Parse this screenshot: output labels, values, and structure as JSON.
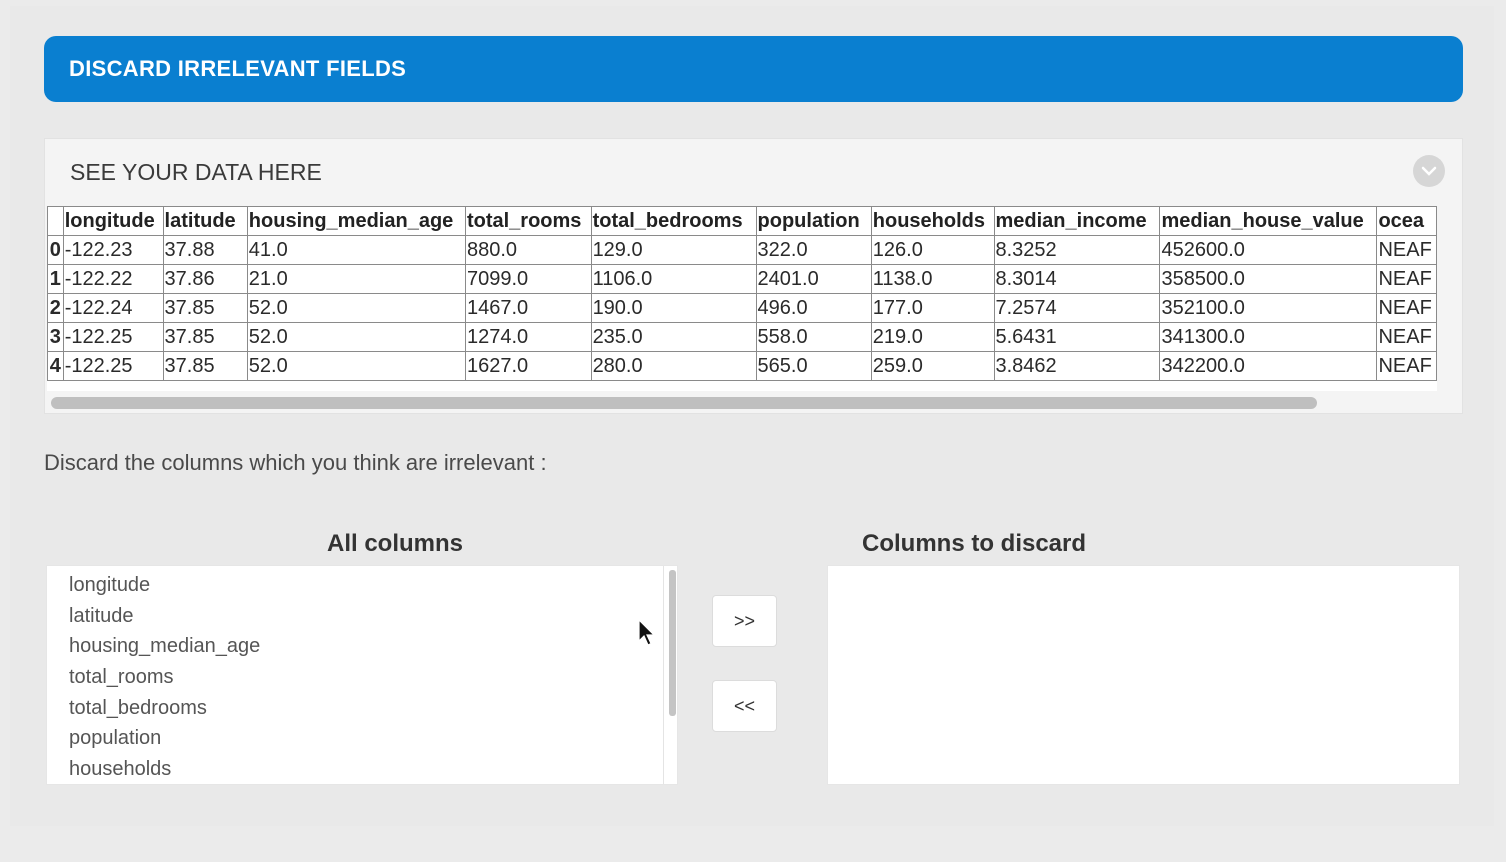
{
  "header": {
    "title": "DISCARD IRRELEVANT FIELDS"
  },
  "preview": {
    "title": "SEE YOUR DATA HERE",
    "columns": [
      "",
      "longitude",
      "latitude",
      "housing_median_age",
      "total_rooms",
      "total_bedrooms",
      "population",
      "households",
      "median_income",
      "median_house_value",
      "ocea"
    ],
    "rows": [
      [
        "0",
        "-122.23",
        "37.88",
        "41.0",
        "880.0",
        "129.0",
        "322.0",
        "126.0",
        "8.3252",
        "452600.0",
        "NEAF"
      ],
      [
        "1",
        "-122.22",
        "37.86",
        "21.0",
        "7099.0",
        "1106.0",
        "2401.0",
        "1138.0",
        "8.3014",
        "358500.0",
        "NEAF"
      ],
      [
        "2",
        "-122.24",
        "37.85",
        "52.0",
        "1467.0",
        "190.0",
        "496.0",
        "177.0",
        "7.2574",
        "352100.0",
        "NEAF"
      ],
      [
        "3",
        "-122.25",
        "37.85",
        "52.0",
        "1274.0",
        "235.0",
        "558.0",
        "219.0",
        "5.6431",
        "341300.0",
        "NEAF"
      ],
      [
        "4",
        "-122.25",
        "37.85",
        "52.0",
        "1627.0",
        "280.0",
        "565.0",
        "259.0",
        "3.8462",
        "342200.0",
        "NEAF"
      ]
    ]
  },
  "instructions": "Discard the columns which you think are irrelevant :",
  "all_columns": {
    "heading": "All columns",
    "items": [
      "longitude",
      "latitude",
      "housing_median_age",
      "total_rooms",
      "total_bedrooms",
      "population",
      "households"
    ]
  },
  "buttons": {
    "add": ">>",
    "remove": "<<"
  },
  "discard_columns": {
    "heading": "Columns to discard",
    "items": []
  },
  "colors": {
    "accent": "#0a7fd0"
  }
}
